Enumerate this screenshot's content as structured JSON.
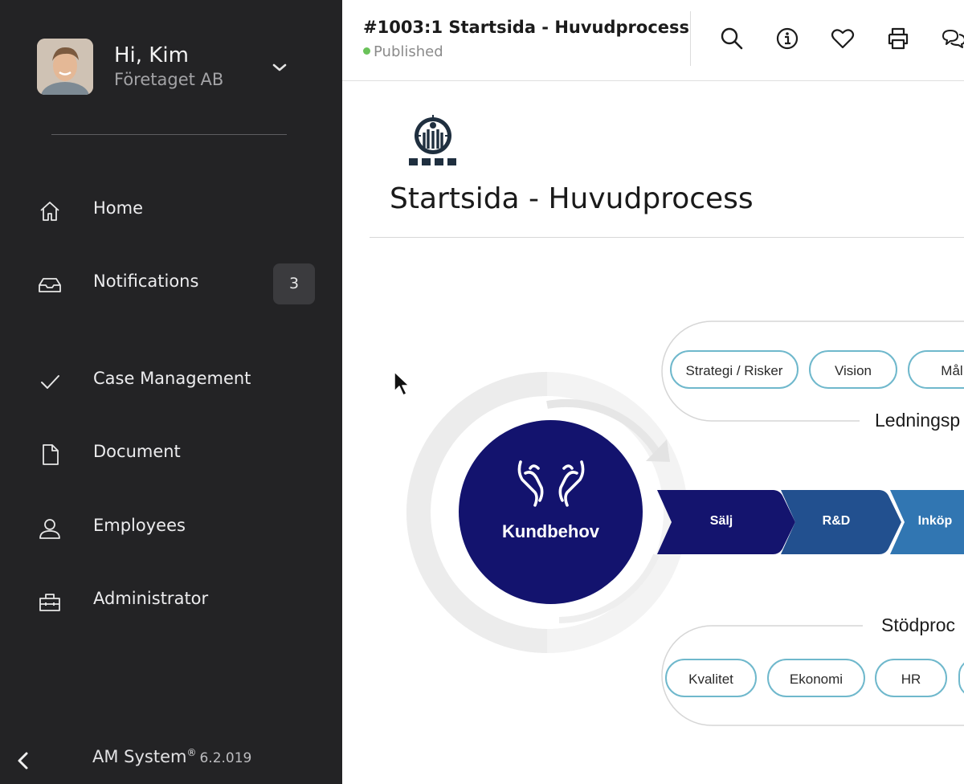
{
  "sidebar": {
    "greeting": "Hi, Kim",
    "company": "Företaget AB",
    "items": [
      {
        "label": "Home",
        "icon": "home-icon"
      },
      {
        "label": "Notifications",
        "icon": "inbox-icon",
        "badge": "3"
      },
      {
        "label": "Case Management",
        "icon": "check-icon"
      },
      {
        "label": "Document",
        "icon": "document-icon"
      },
      {
        "label": "Employees",
        "icon": "user-icon"
      },
      {
        "label": "Administrator",
        "icon": "toolbox-icon"
      }
    ],
    "footer": {
      "brand": "AM System",
      "reg": "®",
      "version": "6.2.019"
    }
  },
  "header": {
    "title": "#1003:1 Startsida - Huvudprocess",
    "status": "Published",
    "status_color": "#6ac259",
    "icons": [
      "search-icon",
      "info-icon",
      "heart-icon",
      "print-icon",
      "comments-icon"
    ]
  },
  "page": {
    "title": "Startsida - Huvudprocess"
  },
  "process": {
    "center_label": "Kundbehov",
    "management_label": "Ledningsp",
    "management_items": [
      "Strategi / Risker",
      "Vision",
      "Mål"
    ],
    "core_steps": [
      "Sälj",
      "R&D",
      "Inköp"
    ],
    "support_label": "Stödproc",
    "support_items": [
      "Kvalitet",
      "Ekonomi",
      "HR"
    ],
    "colors": {
      "center": "#13136e",
      "step1": "#14146e",
      "step2": "#22508f",
      "step3": "#3176b2",
      "pill_border": "#6fb8cc"
    }
  }
}
